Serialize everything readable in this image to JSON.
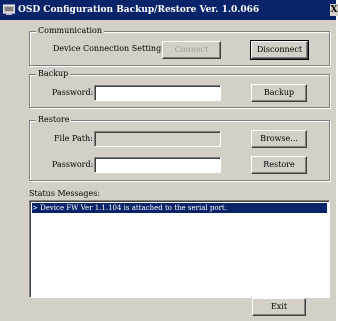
{
  "window": {
    "title": "OSD Configuration Backup/Restore   Ver. 1.0.066",
    "close_glyph": "X"
  },
  "communication": {
    "legend": "Communication",
    "device_label": "Device Connection Setting:",
    "connect_label": "Connect",
    "disconnect_label": "Disconnect"
  },
  "backup": {
    "legend": "Backup",
    "password_label": "Password:",
    "password_value": "",
    "backup_label": "Backup"
  },
  "restore": {
    "legend": "Restore",
    "file_path_label": "File Path:",
    "file_path_value": "",
    "browse_label": "Browse...",
    "password_label": "Password:",
    "password_value": "",
    "restore_label": "Restore"
  },
  "status": {
    "label": "Status Messages:",
    "messages": [
      "> Device FW Ver 1.1.104  is attached to the serial port."
    ]
  },
  "footer": {
    "exit_label": "Exit"
  },
  "colors": {
    "titlebar": "#0a246a",
    "window_bg": "#d4d0c8",
    "selection": "#0a246a"
  }
}
